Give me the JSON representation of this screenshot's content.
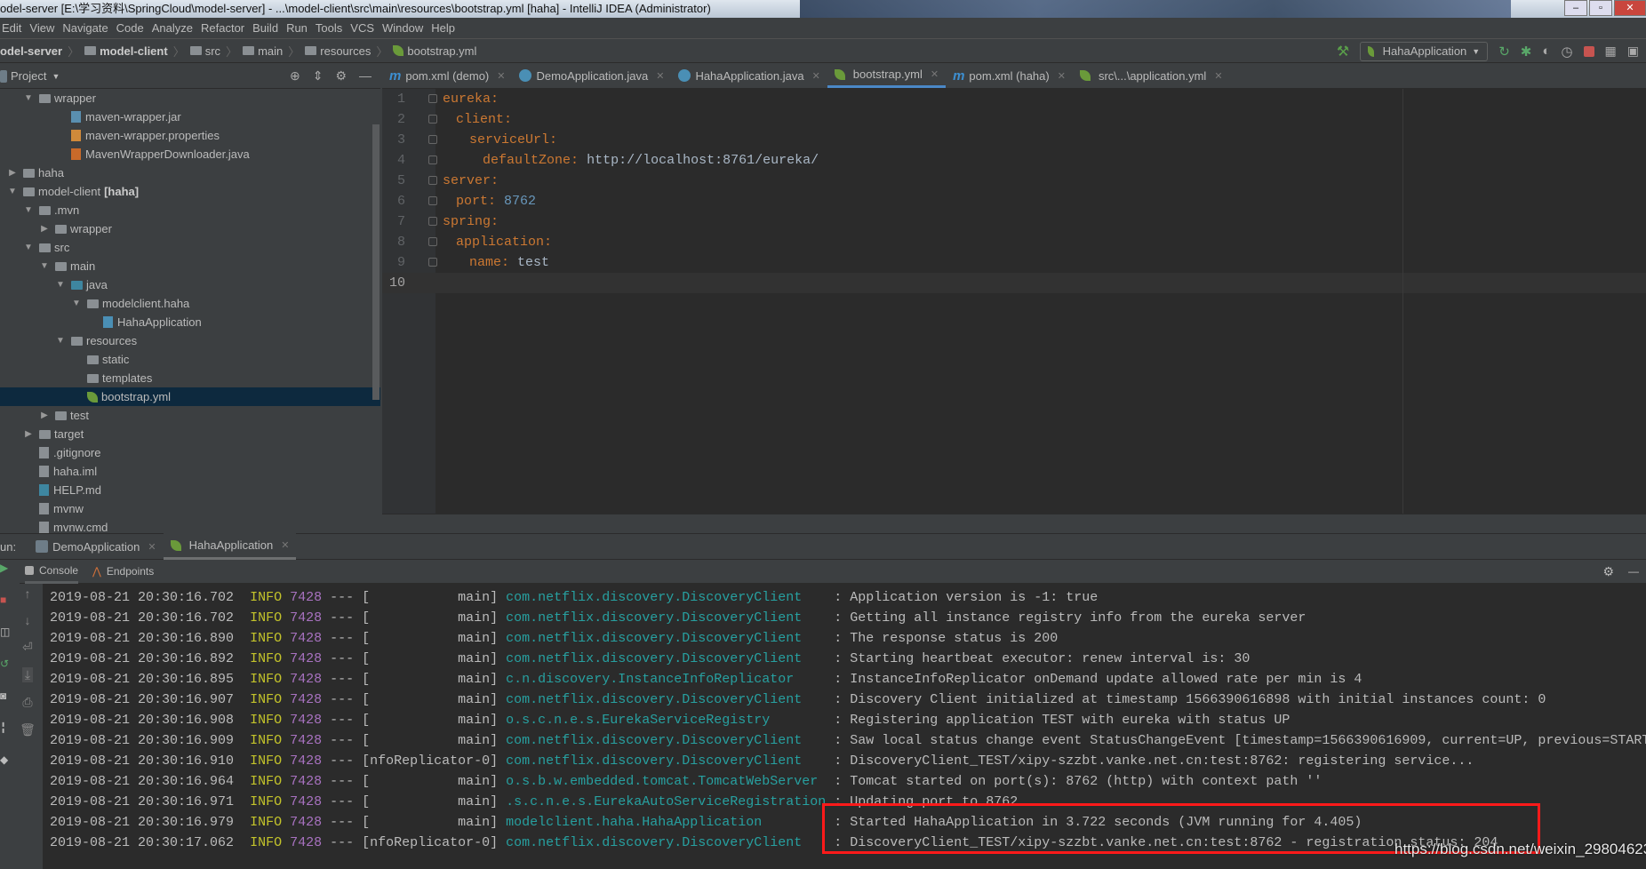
{
  "title_bar": {
    "title": "odel-server [E:\\学习资料\\SpringCloud\\model-server] - ...\\model-client\\src\\main\\resources\\bootstrap.yml [haha] - IntelliJ IDEA (Administrator)"
  },
  "menu": [
    "Edit",
    "View",
    "Navigate",
    "Code",
    "Analyze",
    "Refactor",
    "Build",
    "Run",
    "Tools",
    "VCS",
    "Window",
    "Help"
  ],
  "breadcrumb": [
    "odel-server",
    "model-client",
    "src",
    "main",
    "resources",
    "bootstrap.yml"
  ],
  "run_config": {
    "label": "HahaApplication"
  },
  "project_panel": {
    "title": "Project"
  },
  "tree": [
    {
      "depth": 1,
      "arrow": "down",
      "icon": "folder",
      "label": "wrapper"
    },
    {
      "depth": 3,
      "arrow": "",
      "icon": "jar",
      "label": "maven-wrapper.jar"
    },
    {
      "depth": 3,
      "arrow": "",
      "icon": "properties",
      "label": "maven-wrapper.properties"
    },
    {
      "depth": 3,
      "arrow": "",
      "icon": "java",
      "label": "MavenWrapperDownloader.java"
    },
    {
      "depth": 0,
      "arrow": "right",
      "icon": "folder",
      "label": "haha"
    },
    {
      "depth": 0,
      "arrow": "down",
      "icon": "module",
      "label": "model-client",
      "suffix": "[haha]"
    },
    {
      "depth": 1,
      "arrow": "down",
      "icon": "folder",
      "label": ".mvn"
    },
    {
      "depth": 2,
      "arrow": "right",
      "icon": "folder",
      "label": "wrapper"
    },
    {
      "depth": 1,
      "arrow": "down",
      "icon": "folder",
      "label": "src"
    },
    {
      "depth": 2,
      "arrow": "down",
      "icon": "folder",
      "label": "main"
    },
    {
      "depth": 3,
      "arrow": "down",
      "icon": "source-folder",
      "label": "java"
    },
    {
      "depth": 4,
      "arrow": "down",
      "icon": "package",
      "label": "modelclient.haha"
    },
    {
      "depth": 5,
      "arrow": "",
      "icon": "spring-class",
      "label": "HahaApplication"
    },
    {
      "depth": 3,
      "arrow": "down",
      "icon": "resources-folder",
      "label": "resources"
    },
    {
      "depth": 4,
      "arrow": "",
      "icon": "package",
      "label": "static"
    },
    {
      "depth": 4,
      "arrow": "",
      "icon": "package",
      "label": "templates"
    },
    {
      "depth": 4,
      "arrow": "",
      "icon": "yaml",
      "label": "bootstrap.yml",
      "selected": true
    },
    {
      "depth": 2,
      "arrow": "right",
      "icon": "folder",
      "label": "test"
    },
    {
      "depth": 1,
      "arrow": "right",
      "icon": "folder",
      "label": "target"
    },
    {
      "depth": 1,
      "arrow": "",
      "icon": "gitignore",
      "label": ".gitignore"
    },
    {
      "depth": 1,
      "arrow": "",
      "icon": "iml",
      "label": "haha.iml"
    },
    {
      "depth": 1,
      "arrow": "",
      "icon": "markdown",
      "label": "HELP.md"
    },
    {
      "depth": 1,
      "arrow": "",
      "icon": "shell",
      "label": "mvnw"
    },
    {
      "depth": 1,
      "arrow": "",
      "icon": "text",
      "label": "mvnw.cmd"
    }
  ],
  "editor_tabs": [
    {
      "label": "pom.xml (demo)",
      "icon": "maven"
    },
    {
      "label": "DemoApplication.java",
      "icon": "spring-class"
    },
    {
      "label": "HahaApplication.java",
      "icon": "spring-class"
    },
    {
      "label": "bootstrap.yml",
      "icon": "yaml",
      "active": true
    },
    {
      "label": "pom.xml (haha)",
      "icon": "maven"
    },
    {
      "label": "src\\...\\application.yml",
      "icon": "yaml"
    }
  ],
  "code": [
    {
      "n": "1",
      "indent": 0,
      "key": "eureka",
      "value": "",
      "vtype": ""
    },
    {
      "n": "2",
      "indent": 1,
      "key": "client",
      "value": "",
      "vtype": ""
    },
    {
      "n": "3",
      "indent": 2,
      "key": "serviceUrl",
      "value": "",
      "vtype": ""
    },
    {
      "n": "4",
      "indent": 3,
      "key": "defaultZone",
      "value": "http://localhost:8761/eureka/",
      "vtype": "str"
    },
    {
      "n": "5",
      "indent": 0,
      "key": "server",
      "value": "",
      "vtype": ""
    },
    {
      "n": "6",
      "indent": 1,
      "key": "port",
      "value": "8762",
      "vtype": "num"
    },
    {
      "n": "7",
      "indent": 0,
      "key": "spring",
      "value": "",
      "vtype": ""
    },
    {
      "n": "8",
      "indent": 1,
      "key": "application",
      "value": "",
      "vtype": ""
    },
    {
      "n": "9",
      "indent": 2,
      "key": "name",
      "value": "test",
      "vtype": "str"
    },
    {
      "n": "10",
      "indent": 0,
      "key": "",
      "value": "",
      "vtype": "",
      "current": true
    }
  ],
  "run_panel": {
    "label": "un:",
    "tabs": [
      {
        "label": "DemoApplication"
      },
      {
        "label": "HahaApplication",
        "active": true
      }
    ],
    "sub_tabs": [
      "Console",
      "Endpoints"
    ]
  },
  "console": [
    {
      "date": "2019-08-21 20:30:16.702",
      "level": "INFO",
      "pid": "7428",
      "thread": "main",
      "logger": "com.netflix.discovery.DiscoveryClient",
      "message": "Application version is -1: true"
    },
    {
      "date": "2019-08-21 20:30:16.702",
      "level": "INFO",
      "pid": "7428",
      "thread": "main",
      "logger": "com.netflix.discovery.DiscoveryClient",
      "message": "Getting all instance registry info from the eureka server"
    },
    {
      "date": "2019-08-21 20:30:16.890",
      "level": "INFO",
      "pid": "7428",
      "thread": "main",
      "logger": "com.netflix.discovery.DiscoveryClient",
      "message": "The response status is 200"
    },
    {
      "date": "2019-08-21 20:30:16.892",
      "level": "INFO",
      "pid": "7428",
      "thread": "main",
      "logger": "com.netflix.discovery.DiscoveryClient",
      "message": "Starting heartbeat executor: renew interval is: 30"
    },
    {
      "date": "2019-08-21 20:30:16.895",
      "level": "INFO",
      "pid": "7428",
      "thread": "main",
      "logger": "c.n.discovery.InstanceInfoReplicator",
      "message": "InstanceInfoReplicator onDemand update allowed rate per min is 4"
    },
    {
      "date": "2019-08-21 20:30:16.907",
      "level": "INFO",
      "pid": "7428",
      "thread": "main",
      "logger": "com.netflix.discovery.DiscoveryClient",
      "message": "Discovery Client initialized at timestamp 1566390616898 with initial instances count: 0"
    },
    {
      "date": "2019-08-21 20:30:16.908",
      "level": "INFO",
      "pid": "7428",
      "thread": "main",
      "logger": "o.s.c.n.e.s.EurekaServiceRegistry",
      "message": "Registering application TEST with eureka with status UP"
    },
    {
      "date": "2019-08-21 20:30:16.909",
      "level": "INFO",
      "pid": "7428",
      "thread": "main",
      "logger": "com.netflix.discovery.DiscoveryClient",
      "message": "Saw local status change event StatusChangeEvent [timestamp=1566390616909, current=UP, previous=START"
    },
    {
      "date": "2019-08-21 20:30:16.910",
      "level": "INFO",
      "pid": "7428",
      "thread": "nfoReplicator-0",
      "logger": "com.netflix.discovery.DiscoveryClient",
      "message": "DiscoveryClient_TEST/xipy-szzbt.vanke.net.cn:test:8762: registering service..."
    },
    {
      "date": "2019-08-21 20:30:16.964",
      "level": "INFO",
      "pid": "7428",
      "thread": "main",
      "logger": "o.s.b.w.embedded.tomcat.TomcatWebServer",
      "message": "Tomcat started on port(s): 8762 (http) with context path ''"
    },
    {
      "date": "2019-08-21 20:30:16.971",
      "level": "INFO",
      "pid": "7428",
      "thread": "main",
      "logger": ".s.c.n.e.s.EurekaAutoServiceRegistration",
      "message": "Updating port to 8762"
    },
    {
      "date": "2019-08-21 20:30:16.979",
      "level": "INFO",
      "pid": "7428",
      "thread": "main",
      "logger": "modelclient.haha.HahaApplication",
      "message": "Started HahaApplication in 3.722 seconds (JVM running for 4.405)"
    },
    {
      "date": "2019-08-21 20:30:17.062",
      "level": "INFO",
      "pid": "7428",
      "thread": "nfoReplicator-0",
      "logger": "com.netflix.discovery.DiscoveryClient",
      "message": "DiscoveryClient_TEST/xipy-szzbt.vanke.net.cn:test:8762 - registration status: 204"
    }
  ],
  "watermark": "https://blog.csdn.net/weixin_29804623",
  "colors": {
    "editor_bg": "#2b2b2b",
    "panel_bg": "#3c3f41",
    "selection": "#0d293e",
    "yaml_key": "#cc7832",
    "number": "#6897bb",
    "log_level": "#c3c32b",
    "log_pid": "#a872c0",
    "log_logger": "#27a0a0",
    "highlight_box": "#ff1a1a"
  }
}
